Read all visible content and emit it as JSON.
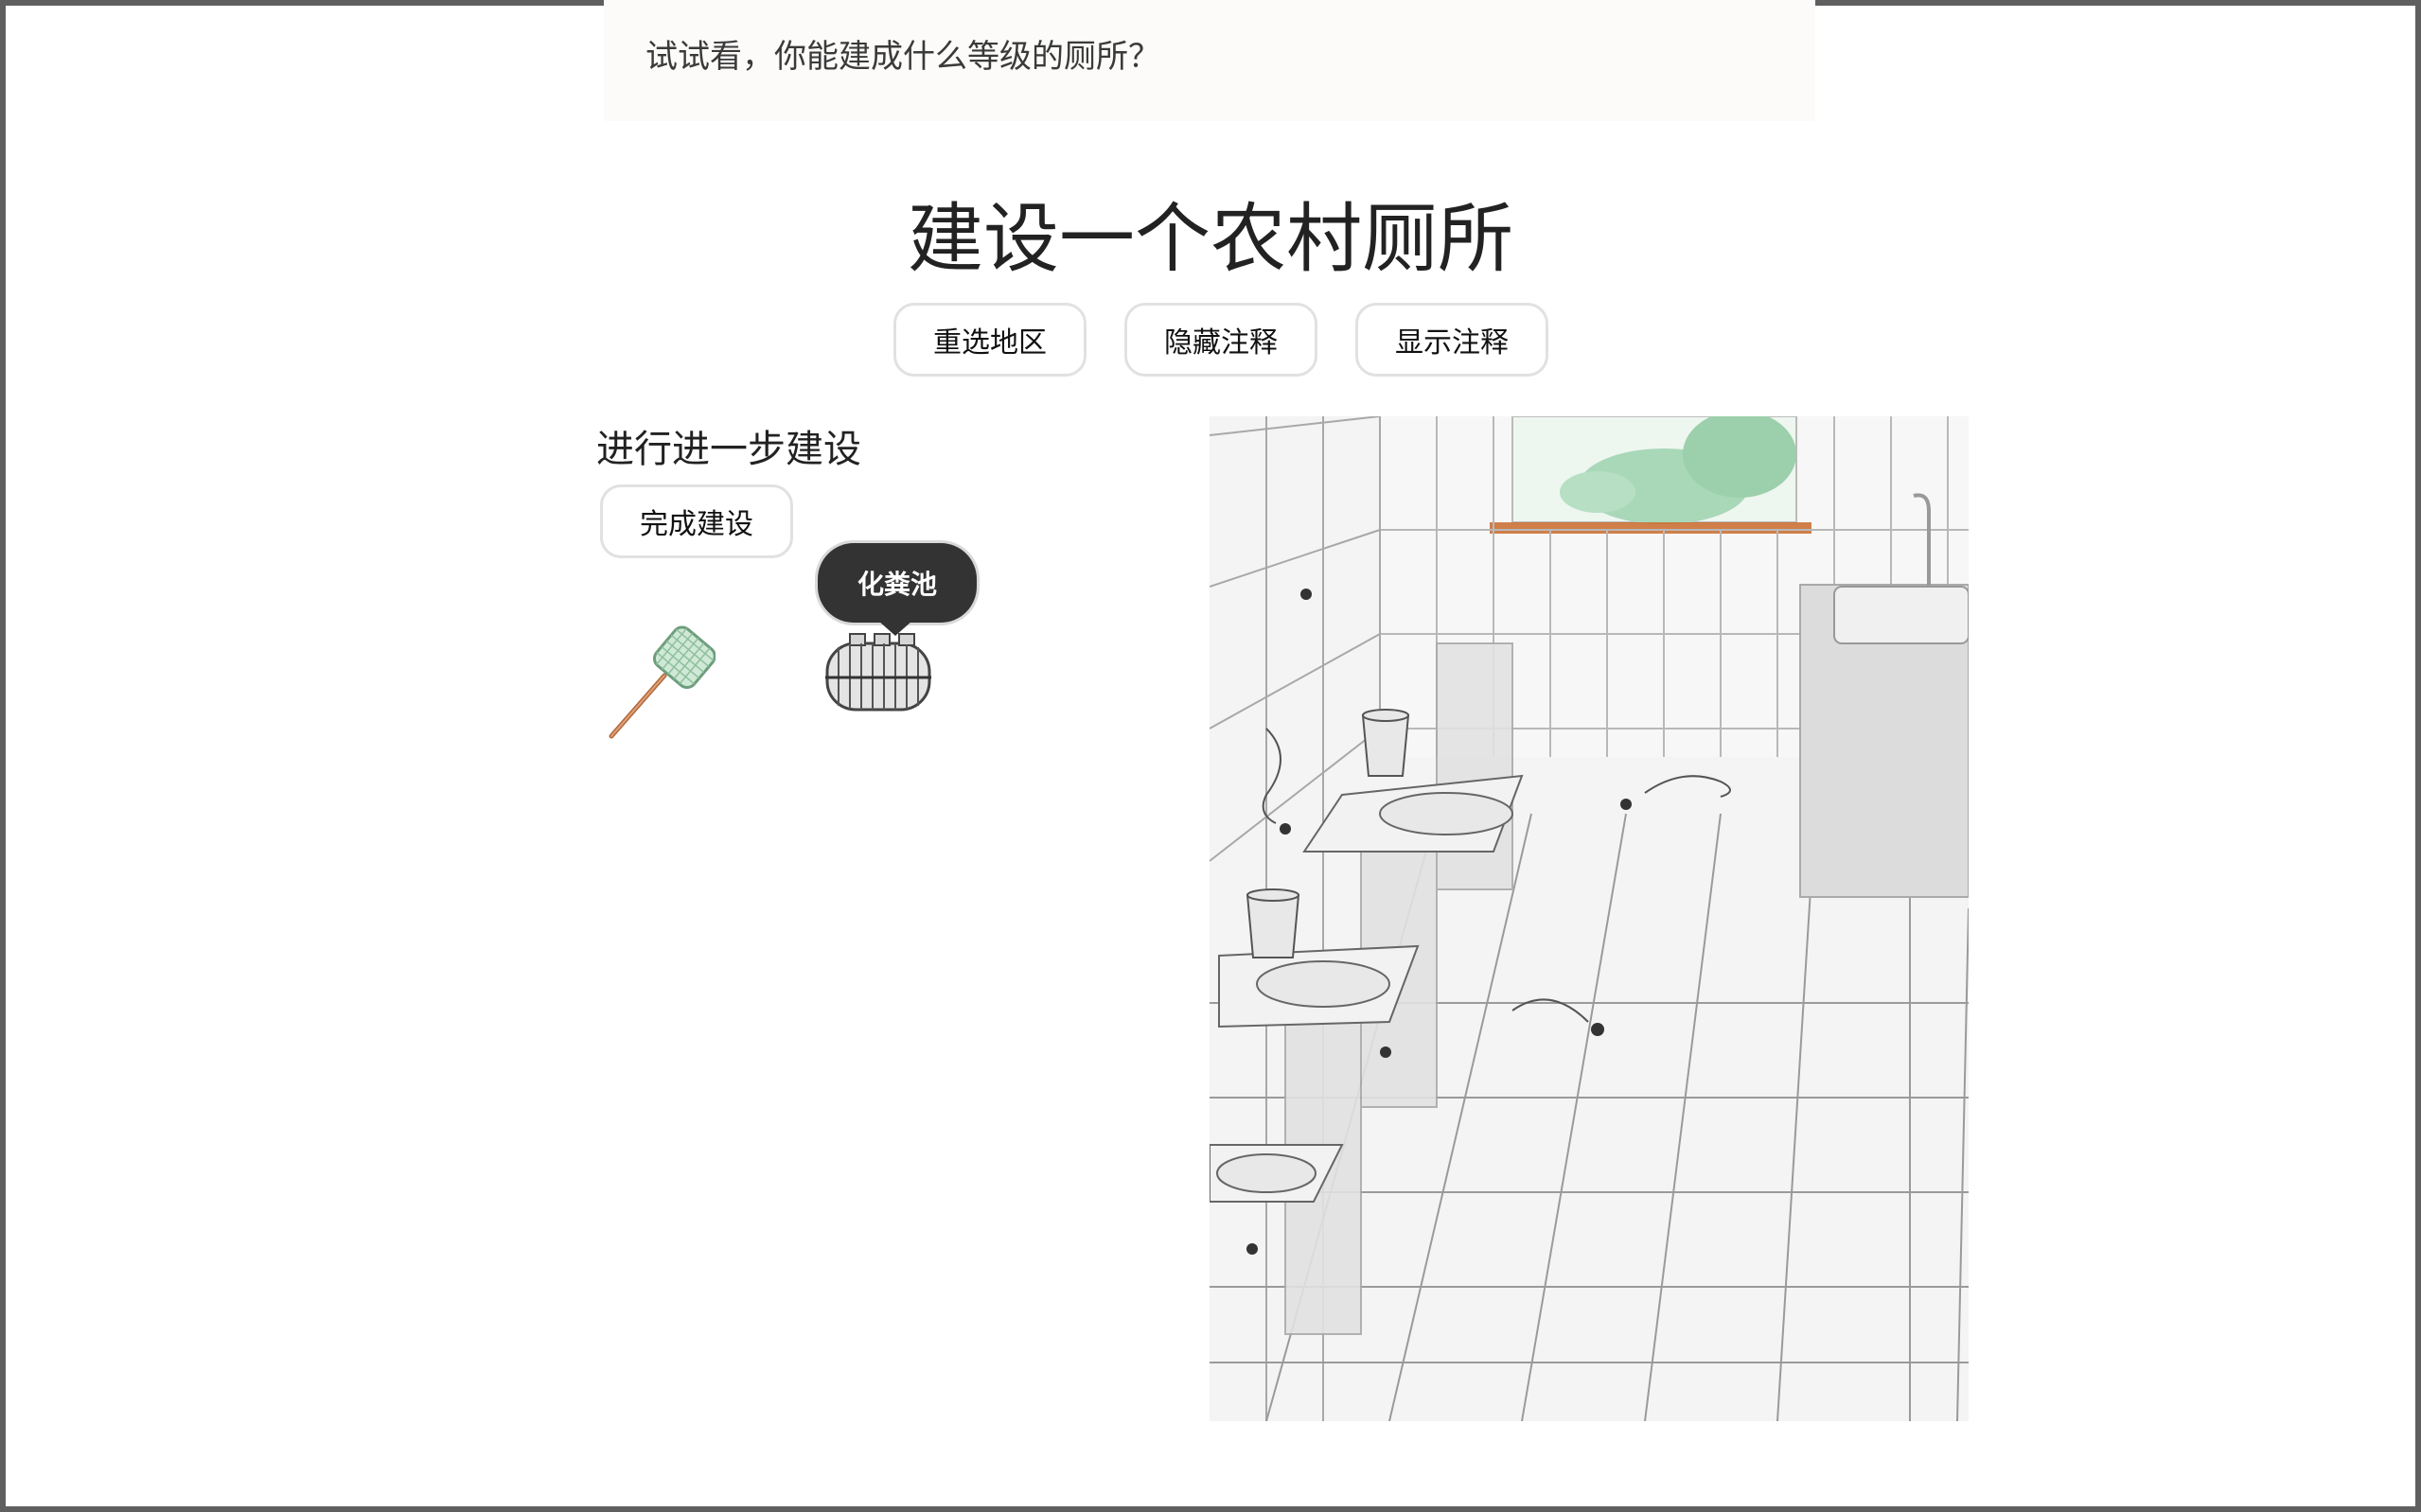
{
  "intro": {
    "text": "试试看，你能建成什么等级的厕所？"
  },
  "page": {
    "title": "建设一个农村厕所"
  },
  "controls": {
    "reselect_label": "重选地区",
    "hide_notes_label": "隐藏注释",
    "show_notes_label": "显示注释"
  },
  "build": {
    "heading": "进行进一步建设",
    "finish_label": "完成建设",
    "items": [
      {
        "icon": "flyswatter-icon"
      },
      {
        "icon": "septic-tank-icon",
        "tooltip": "化粪池"
      }
    ]
  },
  "scene": {
    "description_icon": "toilet-scene-illustration",
    "colors": {
      "tile_line": "#9a9a9a",
      "window_plant": "#a9d8b8",
      "sill": "#c96a2b"
    }
  }
}
